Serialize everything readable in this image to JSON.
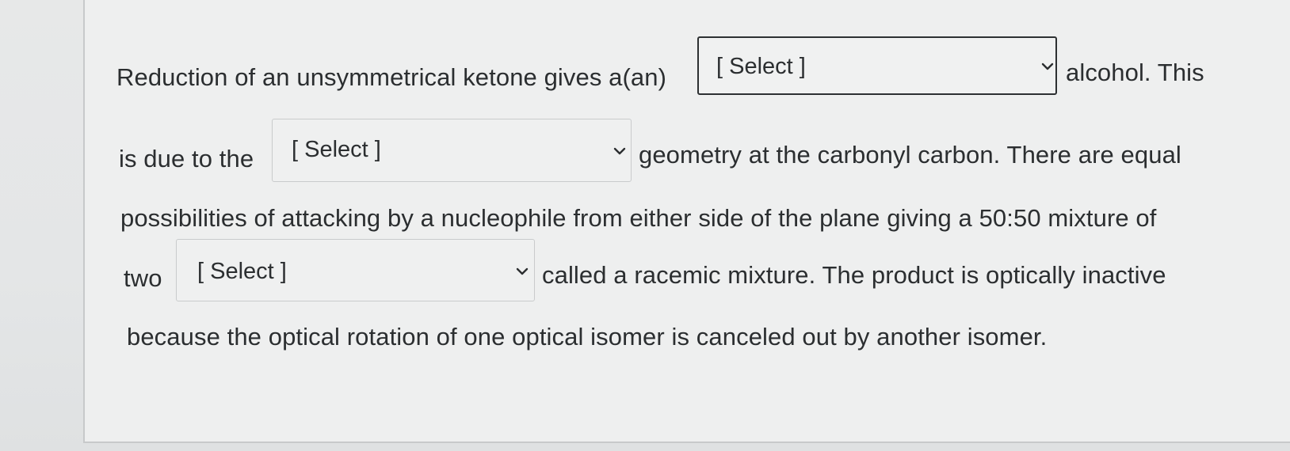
{
  "question": {
    "line1": {
      "before": "Reduction of an unsymmetrical ketone gives a(an)",
      "after": "alcohol. This"
    },
    "line2": {
      "before": "is due to the",
      "after": "geometry at the carbonyl carbon. There are equal"
    },
    "line3": {
      "text": "possibilities of attacking by a nucleophile from either side of the plane giving a 50:50 mixture of"
    },
    "line4": {
      "before": "two",
      "after": "called a racemic mixture. The product is optically inactive"
    },
    "line5": {
      "text": "because the optical rotation of one optical isomer is canceled out by another isomer."
    }
  },
  "dropdowns": [
    {
      "value": "[ Select ]",
      "icon": "chevron-down-icon"
    },
    {
      "value": "[ Select ]",
      "icon": "chevron-down-icon"
    },
    {
      "value": "[ Select ]",
      "icon": "chevron-down-icon"
    }
  ]
}
